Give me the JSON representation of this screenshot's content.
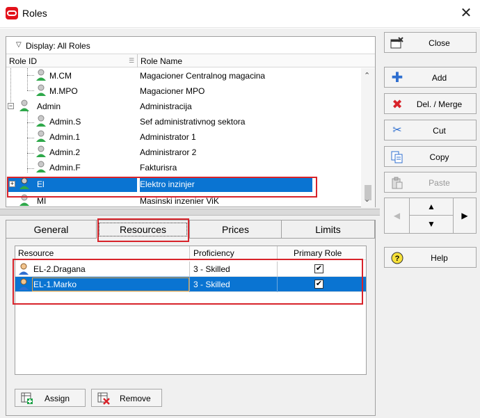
{
  "window": {
    "title": "Roles",
    "close_glyph": "✕"
  },
  "tree": {
    "display_label": "Display: All Roles",
    "col_role_id": "Role ID",
    "col_role_name": "Role Name",
    "rows": [
      {
        "id": "M.CM",
        "name": "Magacioner Centralnog magacina"
      },
      {
        "id": "M.MPO",
        "name": "Magacioner MPO"
      },
      {
        "id": "Admin",
        "name": "Administracija"
      },
      {
        "id": "Admin.S",
        "name": "Sef administrativnog sektora"
      },
      {
        "id": "Admin.1",
        "name": "Administrator 1"
      },
      {
        "id": "Admin.2",
        "name": "Administraror 2"
      },
      {
        "id": "Admin.F",
        "name": "Fakturisra"
      },
      {
        "id": "El",
        "name": "Elektro inzinjer"
      },
      {
        "id": "MI",
        "name": "Masinski inzenier ViK"
      }
    ],
    "expander_admin": "−",
    "expander_el": "+"
  },
  "tabs": {
    "general": "General",
    "resources": "Resources",
    "prices": "Prices",
    "limits": "Limits"
  },
  "resources": {
    "col_resource": "Resource",
    "col_proficiency": "Proficiency",
    "col_primary": "Primary Role",
    "rows": [
      {
        "resource": "EL-2.Dragana",
        "proficiency": "3 - Skilled",
        "primary": "✔"
      },
      {
        "resource": "EL-1.Marko",
        "proficiency": "3 - Skilled",
        "primary": "✔"
      }
    ]
  },
  "bottom_buttons": {
    "assign": "Assign",
    "remove": "Remove"
  },
  "side_buttons": {
    "close": "Close",
    "add": "Add",
    "del_merge": "Del. / Merge",
    "cut": "Cut",
    "copy": "Copy",
    "paste": "Paste",
    "help": "Help"
  },
  "nav": {
    "left": "◀",
    "up": "▲",
    "down": "▼",
    "right": "▶"
  },
  "colors": {
    "selection": "#0a74d2",
    "highlight_box": "#d8232a"
  }
}
